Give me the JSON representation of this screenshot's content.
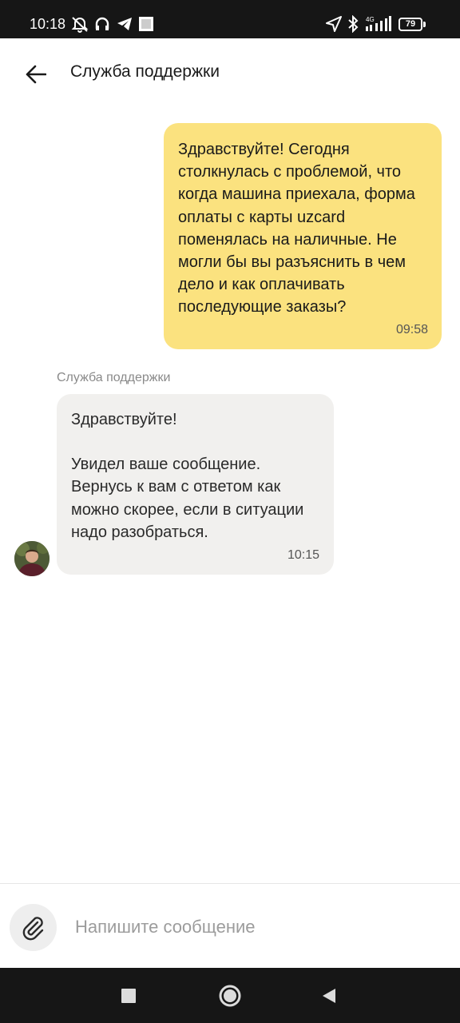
{
  "status_bar": {
    "time": "10:18",
    "battery": "79",
    "network": "4G",
    "icons": [
      "mute-icon",
      "headphones-icon",
      "telegram-icon",
      "image-icon",
      "location-icon",
      "bluetooth-icon",
      "signal-icon",
      "battery-icon"
    ]
  },
  "header": {
    "title": "Служба поддержки",
    "back_icon": "arrow-left-icon"
  },
  "messages": [
    {
      "direction": "outgoing",
      "text": "Здравствуйте! Сегодня столкнулась с проблемой, что когда машина приехала, форма оплаты с карты uzcard поменялась на наличные. Не могли бы вы разъяснить в чем дело и как оплачивать последующие заказы?",
      "time": "09:58",
      "color": "#fbe27f"
    },
    {
      "direction": "incoming",
      "sender": "Служба поддержки",
      "line1": "Здравствуйте!",
      "line2": "Увидел ваше сообщение. Вернусь к вам с ответом как можно скорее, если в ситуации надо разобраться.",
      "time": "10:15",
      "color": "#f1f0ee"
    }
  ],
  "composer": {
    "placeholder": "Напишите сообщение",
    "attach_icon": "paperclip-icon"
  },
  "nav_bar": {
    "icons": [
      "recents-square-icon",
      "home-circle-icon",
      "back-triangle-icon"
    ]
  }
}
